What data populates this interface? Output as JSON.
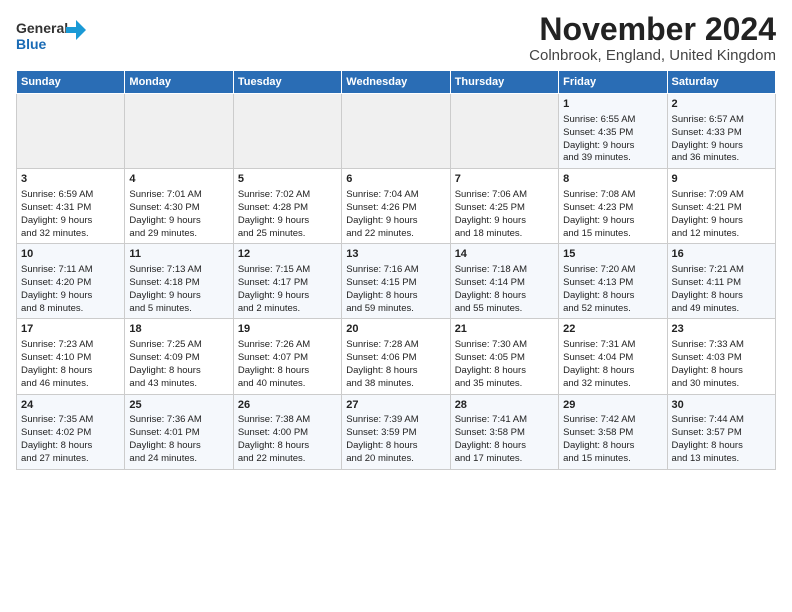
{
  "logo": {
    "line1": "General",
    "line2": "Blue"
  },
  "title": "November 2024",
  "subtitle": "Colnbrook, England, United Kingdom",
  "headers": [
    "Sunday",
    "Monday",
    "Tuesday",
    "Wednesday",
    "Thursday",
    "Friday",
    "Saturday"
  ],
  "weeks": [
    [
      {
        "day": "",
        "info": ""
      },
      {
        "day": "",
        "info": ""
      },
      {
        "day": "",
        "info": ""
      },
      {
        "day": "",
        "info": ""
      },
      {
        "day": "",
        "info": ""
      },
      {
        "day": "1",
        "info": "Sunrise: 6:55 AM\nSunset: 4:35 PM\nDaylight: 9 hours\nand 39 minutes."
      },
      {
        "day": "2",
        "info": "Sunrise: 6:57 AM\nSunset: 4:33 PM\nDaylight: 9 hours\nand 36 minutes."
      }
    ],
    [
      {
        "day": "3",
        "info": "Sunrise: 6:59 AM\nSunset: 4:31 PM\nDaylight: 9 hours\nand 32 minutes."
      },
      {
        "day": "4",
        "info": "Sunrise: 7:01 AM\nSunset: 4:30 PM\nDaylight: 9 hours\nand 29 minutes."
      },
      {
        "day": "5",
        "info": "Sunrise: 7:02 AM\nSunset: 4:28 PM\nDaylight: 9 hours\nand 25 minutes."
      },
      {
        "day": "6",
        "info": "Sunrise: 7:04 AM\nSunset: 4:26 PM\nDaylight: 9 hours\nand 22 minutes."
      },
      {
        "day": "7",
        "info": "Sunrise: 7:06 AM\nSunset: 4:25 PM\nDaylight: 9 hours\nand 18 minutes."
      },
      {
        "day": "8",
        "info": "Sunrise: 7:08 AM\nSunset: 4:23 PM\nDaylight: 9 hours\nand 15 minutes."
      },
      {
        "day": "9",
        "info": "Sunrise: 7:09 AM\nSunset: 4:21 PM\nDaylight: 9 hours\nand 12 minutes."
      }
    ],
    [
      {
        "day": "10",
        "info": "Sunrise: 7:11 AM\nSunset: 4:20 PM\nDaylight: 9 hours\nand 8 minutes."
      },
      {
        "day": "11",
        "info": "Sunrise: 7:13 AM\nSunset: 4:18 PM\nDaylight: 9 hours\nand 5 minutes."
      },
      {
        "day": "12",
        "info": "Sunrise: 7:15 AM\nSunset: 4:17 PM\nDaylight: 9 hours\nand 2 minutes."
      },
      {
        "day": "13",
        "info": "Sunrise: 7:16 AM\nSunset: 4:15 PM\nDaylight: 8 hours\nand 59 minutes."
      },
      {
        "day": "14",
        "info": "Sunrise: 7:18 AM\nSunset: 4:14 PM\nDaylight: 8 hours\nand 55 minutes."
      },
      {
        "day": "15",
        "info": "Sunrise: 7:20 AM\nSunset: 4:13 PM\nDaylight: 8 hours\nand 52 minutes."
      },
      {
        "day": "16",
        "info": "Sunrise: 7:21 AM\nSunset: 4:11 PM\nDaylight: 8 hours\nand 49 minutes."
      }
    ],
    [
      {
        "day": "17",
        "info": "Sunrise: 7:23 AM\nSunset: 4:10 PM\nDaylight: 8 hours\nand 46 minutes."
      },
      {
        "day": "18",
        "info": "Sunrise: 7:25 AM\nSunset: 4:09 PM\nDaylight: 8 hours\nand 43 minutes."
      },
      {
        "day": "19",
        "info": "Sunrise: 7:26 AM\nSunset: 4:07 PM\nDaylight: 8 hours\nand 40 minutes."
      },
      {
        "day": "20",
        "info": "Sunrise: 7:28 AM\nSunset: 4:06 PM\nDaylight: 8 hours\nand 38 minutes."
      },
      {
        "day": "21",
        "info": "Sunrise: 7:30 AM\nSunset: 4:05 PM\nDaylight: 8 hours\nand 35 minutes."
      },
      {
        "day": "22",
        "info": "Sunrise: 7:31 AM\nSunset: 4:04 PM\nDaylight: 8 hours\nand 32 minutes."
      },
      {
        "day": "23",
        "info": "Sunrise: 7:33 AM\nSunset: 4:03 PM\nDaylight: 8 hours\nand 30 minutes."
      }
    ],
    [
      {
        "day": "24",
        "info": "Sunrise: 7:35 AM\nSunset: 4:02 PM\nDaylight: 8 hours\nand 27 minutes."
      },
      {
        "day": "25",
        "info": "Sunrise: 7:36 AM\nSunset: 4:01 PM\nDaylight: 8 hours\nand 24 minutes."
      },
      {
        "day": "26",
        "info": "Sunrise: 7:38 AM\nSunset: 4:00 PM\nDaylight: 8 hours\nand 22 minutes."
      },
      {
        "day": "27",
        "info": "Sunrise: 7:39 AM\nSunset: 3:59 PM\nDaylight: 8 hours\nand 20 minutes."
      },
      {
        "day": "28",
        "info": "Sunrise: 7:41 AM\nSunset: 3:58 PM\nDaylight: 8 hours\nand 17 minutes."
      },
      {
        "day": "29",
        "info": "Sunrise: 7:42 AM\nSunset: 3:58 PM\nDaylight: 8 hours\nand 15 minutes."
      },
      {
        "day": "30",
        "info": "Sunrise: 7:44 AM\nSunset: 3:57 PM\nDaylight: 8 hours\nand 13 minutes."
      }
    ]
  ]
}
